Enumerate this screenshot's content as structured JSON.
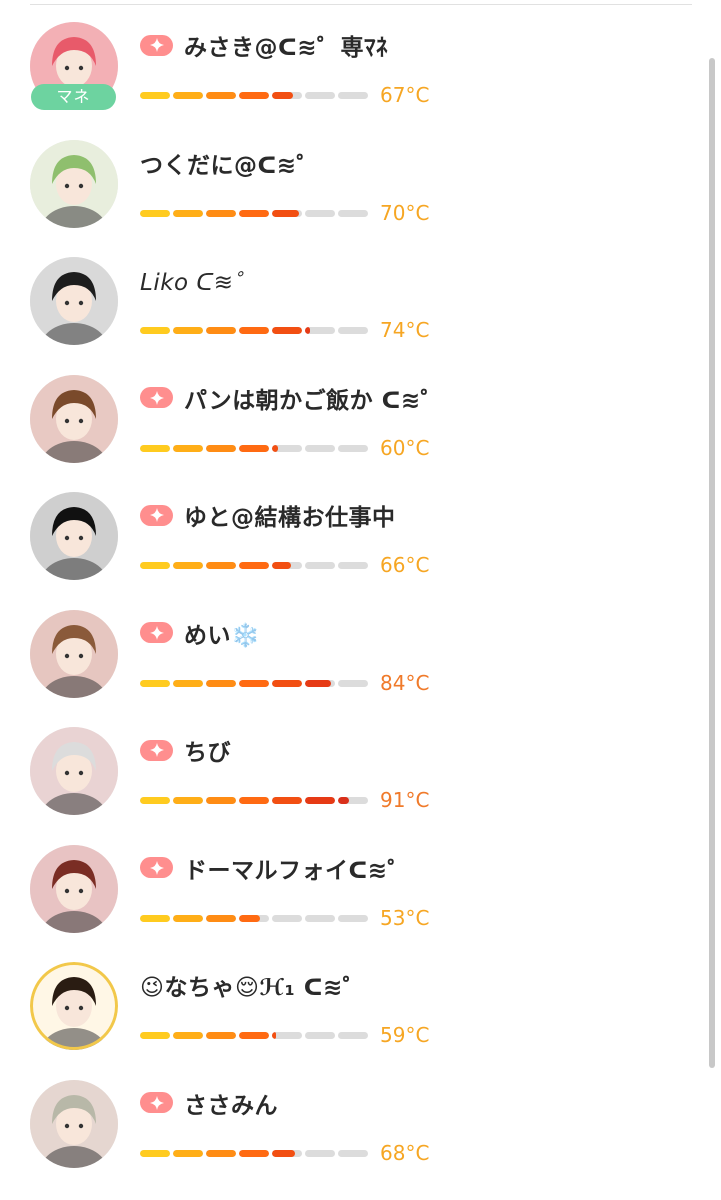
{
  "members": [
    {
      "name": "みさき@ᑕ≋゜専ﾏﾈ",
      "temp": "67°C",
      "level": 0.67,
      "badge": true,
      "role_badge": "マネ",
      "avatar": {
        "bg": "#f3b0b5",
        "hair": "#e85a6a",
        "ring": null
      }
    },
    {
      "name": "つくだに@ᑕ≋゜",
      "temp": "70°C",
      "level": 0.7,
      "badge": false,
      "role_badge": null,
      "avatar": {
        "bg": "#e8eedd",
        "hair": "#8fbf6e",
        "ring": null
      }
    },
    {
      "name": "Liko ᑕ≋゜",
      "temp": "74°C",
      "level": 0.74,
      "badge": false,
      "italic": true,
      "role_badge": null,
      "avatar": {
        "bg": "#d9d9d9",
        "hair": "#1d1d1d",
        "ring": null
      }
    },
    {
      "name": "パンは朝かご飯か ᑕ≋゜",
      "temp": "60°C",
      "level": 0.6,
      "badge": true,
      "role_badge": null,
      "avatar": {
        "bg": "#e8c9c3",
        "hair": "#7a4a2b",
        "ring": null
      }
    },
    {
      "name": "ゆと@結構お仕事中",
      "temp": "66°C",
      "level": 0.66,
      "badge": true,
      "role_badge": null,
      "avatar": {
        "bg": "#cfcfcf",
        "hair": "#111111",
        "ring": null
      }
    },
    {
      "name": "めい❄️",
      "temp": "84°C",
      "level": 0.84,
      "badge": true,
      "role_badge": null,
      "avatar": {
        "bg": "#e6c6c0",
        "hair": "#8a5a3a",
        "ring": null
      }
    },
    {
      "name": "ちび",
      "temp": "91°C",
      "level": 0.91,
      "badge": true,
      "role_badge": null,
      "avatar": {
        "bg": "#e9d3d3",
        "hair": "#dcdcdc",
        "ring": null
      }
    },
    {
      "name": "ドーマルフォイᑕ≋゜",
      "temp": "53°C",
      "level": 0.53,
      "badge": true,
      "role_badge": null,
      "avatar": {
        "bg": "#e8c3c3",
        "hair": "#7a2d24",
        "ring": null
      }
    },
    {
      "name": "😉なちゃ😌ℋ₁ ᑕ≋゜",
      "temp": "59°C",
      "level": 0.59,
      "badge": false,
      "role_badge": null,
      "avatar": {
        "bg": "#fff7e6",
        "hair": "#2a1c12",
        "ring": "#f2c84a"
      }
    },
    {
      "name": "ささみん",
      "temp": "68°C",
      "level": 0.68,
      "badge": true,
      "role_badge": null,
      "avatar": {
        "bg": "#e5d6d0",
        "hair": "#b8b8a8",
        "ring": null
      }
    }
  ],
  "colors": {
    "temp_low": "#f6a623",
    "temp_high": "#f07a2a",
    "seg_empty": "#dcdcdc",
    "seg_ramp": [
      "#ffcb1f",
      "#ffae17",
      "#ff8c14",
      "#ff6a12",
      "#f24f12",
      "#e63a15",
      "#d9301a"
    ],
    "badge": "#ff8e8e",
    "role_badge": "#6dd3a0"
  }
}
